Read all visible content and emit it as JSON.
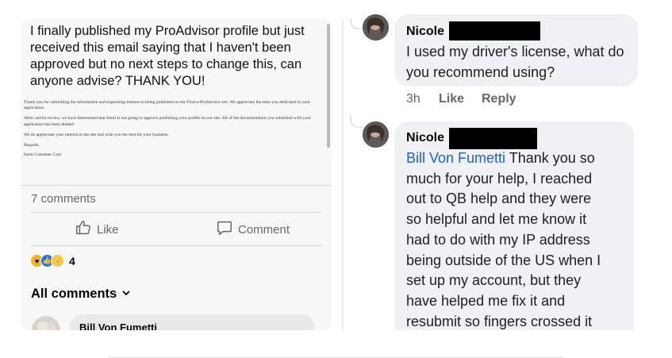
{
  "post": {
    "text": "I finally published my ProAdvisor profile but just received this email saying that I haven't been approved but no next steps to change this, can anyone advise? THANK YOU!",
    "email_paragraphs": [
      "Thank you for submitting the information and expressing interest in being published on the Find-a-ProAdvisor site. We appreciate the time you dedicated to your application.",
      "After careful review, we have determined that Intuit is not going to approve publishing your profile on our site. All of the documentation you submitted with your application has been deleted",
      "We do appreciate your interest in the site and wish you the best for your business.",
      "Regards,",
      "Intuit Customer Care"
    ],
    "comments_count": "7 comments",
    "like_label": "Like",
    "comment_label": "Comment",
    "reaction_count": "4",
    "all_comments_label": "All comments",
    "first_commenter": "Bill Von Fumetti"
  },
  "replies": [
    {
      "name": "Nicole",
      "text": "I used my driver's license, what do you recommend using?",
      "time": "3h",
      "like": "Like",
      "reply": "Reply"
    },
    {
      "name": "Nicole",
      "mention": "Bill Von Fumetti",
      "lines": [
        " Thank you so",
        "much for your help, I reached",
        "out to QB help and they were",
        "so helpful and let me know it",
        "had to do with my IP address",
        "being outside of the US when I",
        "set up my account, but they",
        "have helped me fix it and",
        "resubmit so fingers crossed it"
      ]
    }
  ],
  "colors": {
    "accent_link": "#1b62d6",
    "meta_gray": "#65676b",
    "bubble_bg": "#f0f1f4"
  },
  "icons": [
    "thumbs-up-icon",
    "comment-icon",
    "chevron-down-icon",
    "care-reaction-icon",
    "like-reaction-icon",
    "sad-reaction-icon"
  ]
}
